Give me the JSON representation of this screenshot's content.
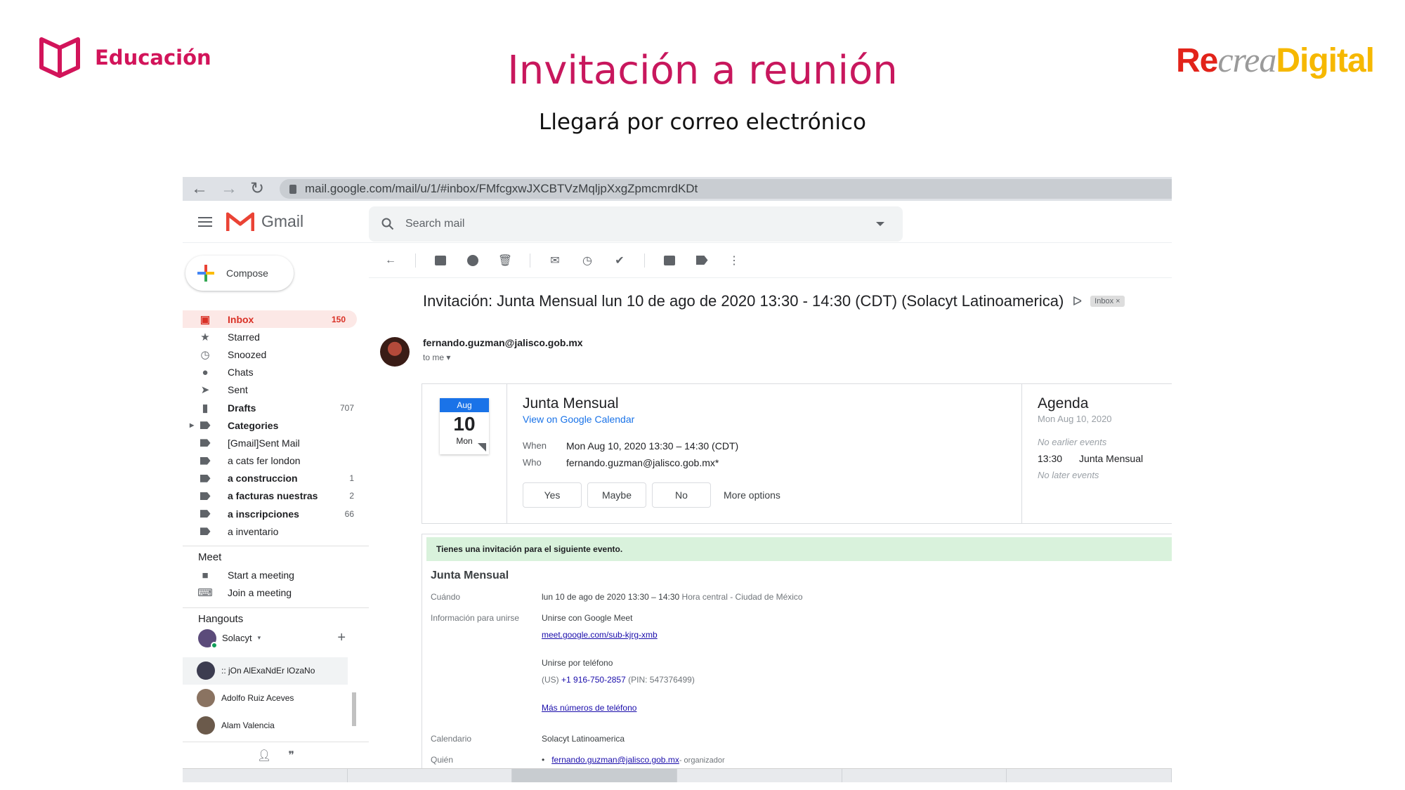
{
  "slide": {
    "brand": "Educación",
    "title": "Invitación a reunión",
    "subtitle": "Llegará por correo electrónico",
    "logo": {
      "part1": "Re",
      "part2": "crea",
      "part3": "Digital"
    }
  },
  "browser": {
    "url": "mail.google.com/mail/u/1/#inbox/FMfcgxwJXCBTVzMqljpXxgZpmcmrdKDt"
  },
  "gmail": {
    "app_name": "Gmail",
    "search_placeholder": "Search mail",
    "compose_label": "Compose",
    "nav": [
      {
        "label": "Inbox",
        "count": "150",
        "icon": "inbox-icon"
      },
      {
        "label": "Starred",
        "count": "",
        "icon": "star-icon"
      },
      {
        "label": "Snoozed",
        "count": "",
        "icon": "clock-icon"
      },
      {
        "label": "Chats",
        "count": "",
        "icon": "chat-icon"
      },
      {
        "label": "Sent",
        "count": "",
        "icon": "send-icon"
      },
      {
        "label": "Drafts",
        "count": "707",
        "icon": "draft-icon"
      },
      {
        "label": "Categories",
        "count": "",
        "icon": "label-icon"
      },
      {
        "label": "[Gmail]Sent Mail",
        "count": "",
        "icon": "label-icon"
      },
      {
        "label": "a cats fer london",
        "count": "",
        "icon": "label-icon"
      },
      {
        "label": "a construccion",
        "count": "1",
        "icon": "label-icon"
      },
      {
        "label": "a facturas nuestras",
        "count": "2",
        "icon": "label-icon"
      },
      {
        "label": "a inscripciones",
        "count": "66",
        "icon": "label-icon"
      },
      {
        "label": "a inventario",
        "count": "",
        "icon": "label-icon"
      }
    ],
    "meet": {
      "title": "Meet",
      "start": "Start a meeting",
      "join": "Join a meeting"
    },
    "hangouts": {
      "title": "Hangouts",
      "me": "Solacyt",
      "contacts": [
        {
          "name": ":: jOn AlExaNdEr lOzaNo"
        },
        {
          "name": "Adolfo Ruiz Aceves"
        },
        {
          "name": "Alam Valencia"
        }
      ]
    }
  },
  "email": {
    "subject": "Invitación: Junta Mensual lun 10 de ago de 2020 13:30 - 14:30 (CDT) (Solacyt Latinoamerica)",
    "chip": "Inbox ×",
    "sender": "fernando.guzman@jalisco.gob.mx",
    "to_me": "to me ▾",
    "invite": {
      "cal_month": "Aug",
      "cal_day": "10",
      "cal_dow": "Mon",
      "title": "Junta Mensual",
      "view_link": "View on Google Calendar",
      "when_label": "When",
      "when_value": "Mon Aug 10, 2020 13:30 – 14:30 (CDT)",
      "who_label": "Who",
      "who_value": "fernando.guzman@jalisco.gob.mx*",
      "yes": "Yes",
      "maybe": "Maybe",
      "no": "No",
      "more": "More options"
    },
    "agenda": {
      "title": "Agenda",
      "date": "Mon Aug 10, 2020",
      "no_earlier": "No earlier events",
      "event_time": "13:30",
      "event_name": "Junta Mensual",
      "no_later": "No later events"
    },
    "body": {
      "banner": "Tienes una invitación para el siguiente evento.",
      "title": "Junta Mensual",
      "when_label": "Cuándo",
      "when_value": "lun 10 de ago de 2020 13:30 – 14:30",
      "when_tz": "Hora central - Ciudad de México",
      "join_label": "Información para unirse",
      "join_meet": "Unirse con Google Meet",
      "meet_link": "meet.google.com/sub-kjrg-xmb",
      "join_phone": "Unirse por teléfono",
      "phone_prefix": "(US)",
      "phone_number": "+1 916-750-2857",
      "phone_pin": "(PIN: 547376499)",
      "more_numbers": "Más números de teléfono",
      "calendar_label": "Calendario",
      "calendar_value": "Solacyt Latinoamerica",
      "who_label": "Quién",
      "who_link": "fernando.guzman@jalisco.gob.mx",
      "who_role": "- organizador"
    }
  }
}
